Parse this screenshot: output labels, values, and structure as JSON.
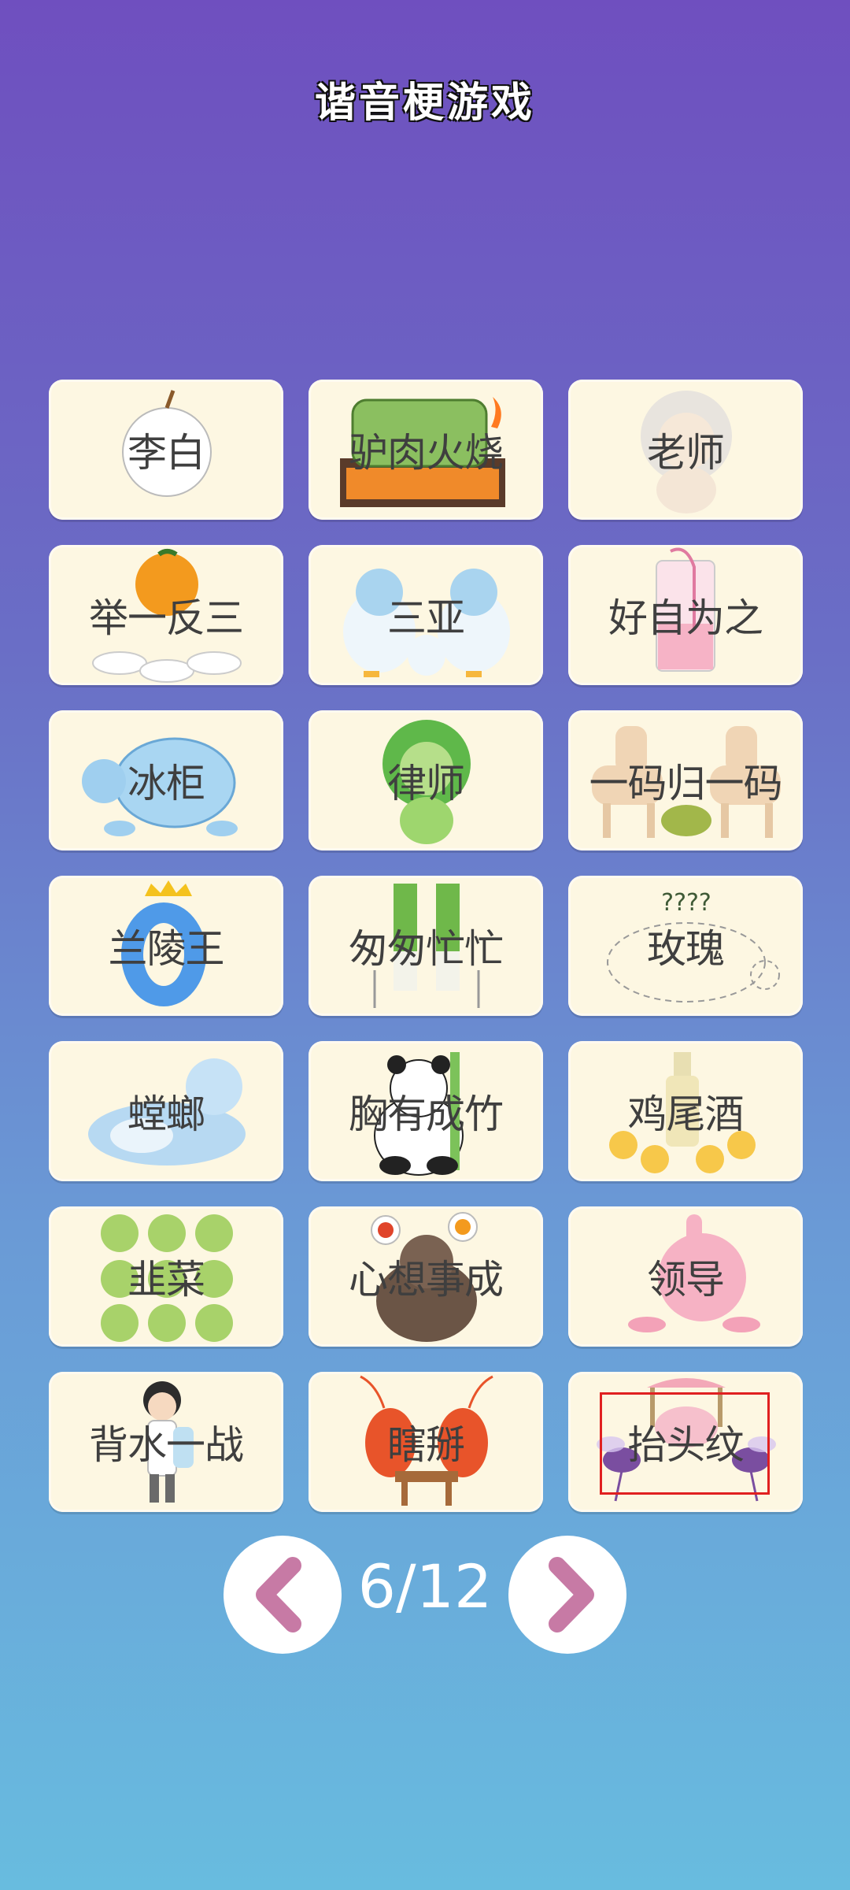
{
  "header": {
    "title": "谐音梗游戏"
  },
  "cards": [
    {
      "label": "李白",
      "art": "white-pear"
    },
    {
      "label": "驴肉火烧",
      "art": "grilled-green-meat"
    },
    {
      "label": "老师",
      "art": "old-lion"
    },
    {
      "label": "举一反三",
      "art": "orange-on-bowls"
    },
    {
      "label": "三亚",
      "art": "three-ducks"
    },
    {
      "label": "好自为之",
      "art": "glass-with-straw"
    },
    {
      "label": "冰柜",
      "art": "ice-turtle"
    },
    {
      "label": "律师",
      "art": "green-lion"
    },
    {
      "label": "一码归一码",
      "art": "horses-and-turtle"
    },
    {
      "label": "兰陵王",
      "art": "blue-zero-crown"
    },
    {
      "label": "匆匆忙忙",
      "art": "scallion-characters"
    },
    {
      "label": "玫瑰",
      "art": "dashed-turtle-question",
      "extra": "????"
    },
    {
      "label": "螳螂",
      "art": "lying-blue-wolf"
    },
    {
      "label": "胸有成竹",
      "art": "panda-bamboo"
    },
    {
      "label": "鸡尾酒",
      "art": "chicks-and-bottle"
    },
    {
      "label": "韭菜",
      "art": "nine-cabbages"
    },
    {
      "label": "心想事成",
      "art": "gorilla-orange-tomato"
    },
    {
      "label": "领导",
      "art": "pink-balloon-falling"
    },
    {
      "label": "背水一战",
      "art": "boy-water-bottle"
    },
    {
      "label": "瞎掰",
      "art": "shrimp-at-table"
    },
    {
      "label": "抬头纹",
      "art": "mosquitoes-carry-pig",
      "selected": true
    }
  ],
  "pagination": {
    "current": "6",
    "total": "12",
    "indicator": "6/12",
    "prev_icon": "chevron-left-icon",
    "next_icon": "chevron-right-icon"
  },
  "colors": {
    "chevron": "#c77aa5",
    "card_bg": "#fdf7e2",
    "selection_border": "#e02020"
  }
}
